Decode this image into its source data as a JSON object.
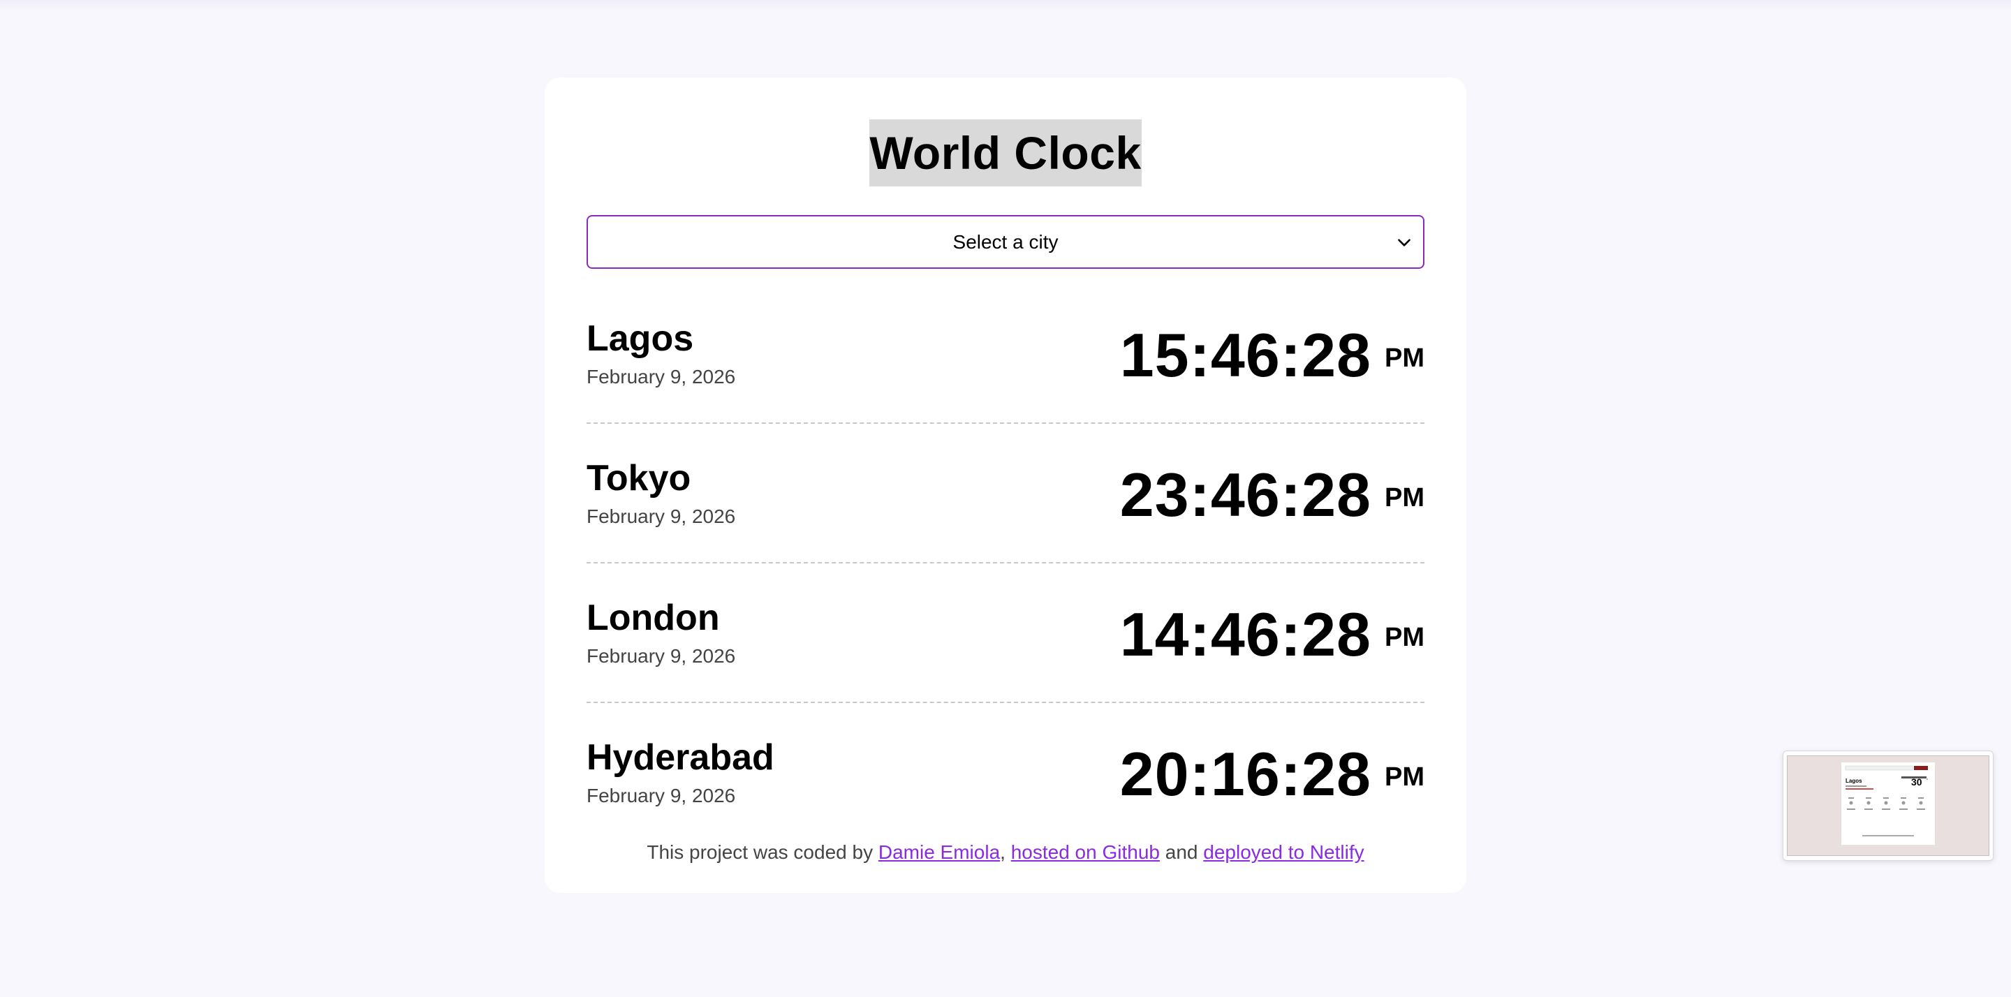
{
  "app": {
    "title": "World Clock"
  },
  "city_select": {
    "selected_label": "Select a city"
  },
  "cities": [
    {
      "name": "Lagos",
      "date": "February 9, 2026",
      "time": "15:46:28",
      "ampm": "PM"
    },
    {
      "name": "Tokyo",
      "date": "February 9, 2026",
      "time": "23:46:28",
      "ampm": "PM"
    },
    {
      "name": "London",
      "date": "February 9, 2026",
      "time": "14:46:28",
      "ampm": "PM"
    },
    {
      "name": "Hyderabad",
      "date": "February 9, 2026",
      "time": "20:16:28",
      "ampm": "PM"
    }
  ],
  "footer": {
    "prefix": "This project was coded by ",
    "author_link": "Damie Emiola",
    "sep1": ", ",
    "github_link": "hosted on Github",
    "sep2": " and ",
    "netlify_link": "deployed to Netlify"
  },
  "thumbnail": {
    "city": "Lagos",
    "temperature": "30"
  },
  "colors": {
    "accent": "#8a2be2",
    "page_background": "#f8f7fd",
    "card_background": "#ffffff",
    "title_highlight": "#d9d9d9"
  },
  "icons": {
    "select_chevron": "chevron-down-icon"
  }
}
